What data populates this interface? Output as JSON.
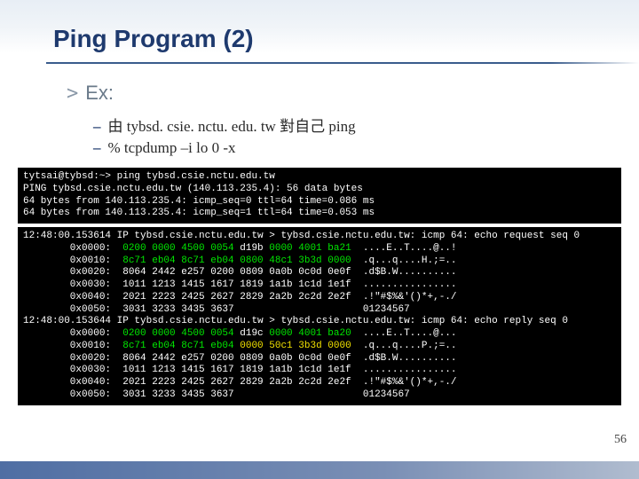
{
  "title": "Ping Program (2)",
  "ex": {
    "arrow": ">",
    "label": "Ex:"
  },
  "sub": {
    "dash": "–",
    "item1_prefix": "由",
    "item1_host": "tybsd. csie. nctu. edu. tw",
    "item1_mid": "對自己",
    "item1_cmd": "ping",
    "item2": "% tcpdump –i lo 0 -x"
  },
  "term1": {
    "l1a": "tytsai@tybsd:~>",
    "l1b": " ping tybsd.csie.nctu.edu.tw",
    "l2": "PING tybsd.csie.nctu.edu.tw (140.113.235.4): 56 data bytes",
    "l3": "64 bytes from 140.113.235.4: icmp_seq=0 ttl=64 time=0.086 ms",
    "l4": "64 bytes from 140.113.235.4: icmp_seq=1 ttl=64 time=0.053 ms"
  },
  "term2": {
    "r1_ts": "12:48:00.153614",
    "r1_hdr": " IP tybsd.csie.nctu.edu.tw > tybsd.csie.nctu.edu.tw: icmp 64: echo request seq 0",
    "x0000a": "        0x0000:  ",
    "x0000g": "0200 0000 4500 0054",
    "x0000w": " d19b ",
    "x0000g2": "0000 4001 ba21",
    "x0000t": "  ....E..T....@..!",
    "x0010a": "        0x0010:  ",
    "x0010g": "8c71 eb04 8c71 eb04 0800 48c1 3b3d 0000",
    "x0010t": "  .q...q....H.;=..",
    "x0020a": "        0x0020:  8064 2442 e257 0200 0809 0a0b 0c0d 0e0f",
    "x0020t": "  .d$B.W..........",
    "x0030a": "        0x0030:  1011 1213 1415 1617 1819 1a1b 1c1d 1e1f",
    "x0030t": "  ................",
    "x0040a": "        0x0040:  2021 2223 2425 2627 2829 2a2b 2c2d 2e2f",
    "x0040t": "  .!\"#$%&'()*+,-./",
    "x0050a": "        0x0050:  3031 3233 3435 3637",
    "x0050t": "                      01234567",
    "r2_ts": "12:48:00.153644",
    "r2_hdr": " IP tybsd.csie.nctu.edu.tw > tybsd.csie.nctu.edu.tw: icmp 64: echo reply seq 0",
    "y0000a": "        0x0000:  ",
    "y0000g": "0200 0000 4500 0054",
    "y0000w": " d19c ",
    "y0000g2": "0000 4001 ba20",
    "y0000t": "  ....E..T....@...",
    "y0010a": "        0x0010:  ",
    "y0010g": "8c71 eb04 8c71 eb04 ",
    "y0010y": "0000 50c1 3b3d 0000",
    "y0010t": "  .q...q....P.;=..",
    "y0020a": "        0x0020:  8064 2442 e257 0200 0809 0a0b 0c0d 0e0f",
    "y0020t": "  .d$B.W..........",
    "y0030a": "        0x0030:  1011 1213 1415 1617 1819 1a1b 1c1d 1e1f",
    "y0030t": "  ................",
    "y0040a": "        0x0040:  2021 2223 2425 2627 2829 2a2b 2c2d 2e2f",
    "y0040t": "  .!\"#$%&'()*+,-./",
    "y0050a": "        0x0050:  3031 3233 3435 3637",
    "y0050t": "                      01234567"
  },
  "page_num": "56"
}
